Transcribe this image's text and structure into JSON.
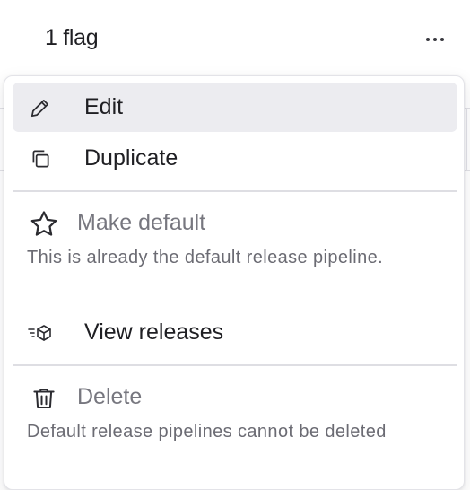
{
  "header": {
    "title": "1 flag"
  },
  "menu": {
    "items": [
      {
        "label": "Edit",
        "icon": "pencil-icon"
      },
      {
        "label": "Duplicate",
        "icon": "duplicate-icon"
      }
    ],
    "make_default": {
      "label": "Make default",
      "icon": "star-icon",
      "description": "This is already the default release pipeline."
    },
    "view_releases": {
      "label": "View releases",
      "icon": "releases-icon"
    },
    "delete": {
      "label": "Delete",
      "icon": "trash-icon",
      "description": "Default release pipelines cannot be deleted"
    }
  }
}
